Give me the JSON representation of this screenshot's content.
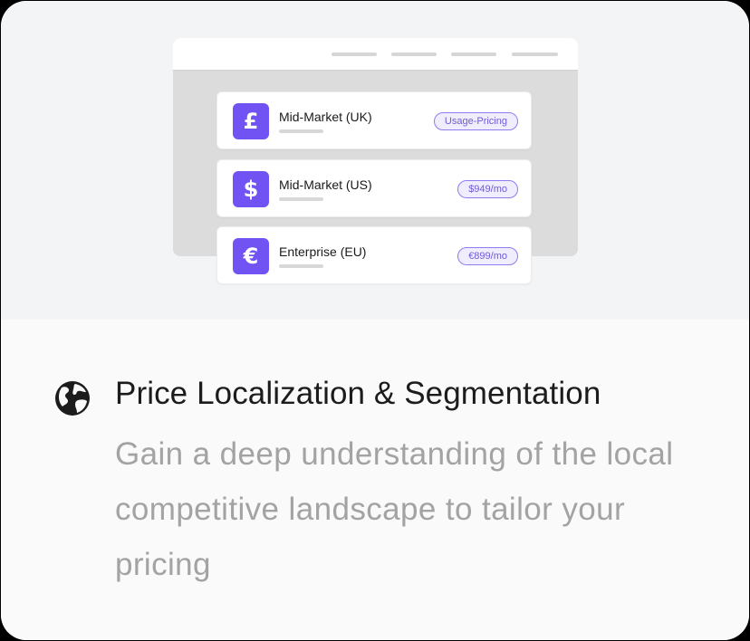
{
  "segments": [
    {
      "currency_symbol": "£",
      "icon": "pound-icon",
      "name": "Mid-Market (UK)",
      "price": "Usage-Pricing"
    },
    {
      "currency_symbol": "$",
      "icon": "dollar-icon",
      "name": "Mid-Market (US)",
      "price": "$949/mo"
    },
    {
      "currency_symbol": "€",
      "icon": "euro-icon",
      "name": "Enterprise (EU)",
      "price": "€899/mo"
    }
  ],
  "feature": {
    "icon": "globe-icon",
    "title": "Price Localization & Segmentation",
    "description": "Gain a deep understanding of the local competitive landscape to tailor your pricing"
  },
  "colors": {
    "accent": "#7152f3",
    "pill_background": "#f0edff",
    "pill_border": "#8f7cf0",
    "title": "#1c1c1c",
    "description": "#a3a3a3"
  }
}
